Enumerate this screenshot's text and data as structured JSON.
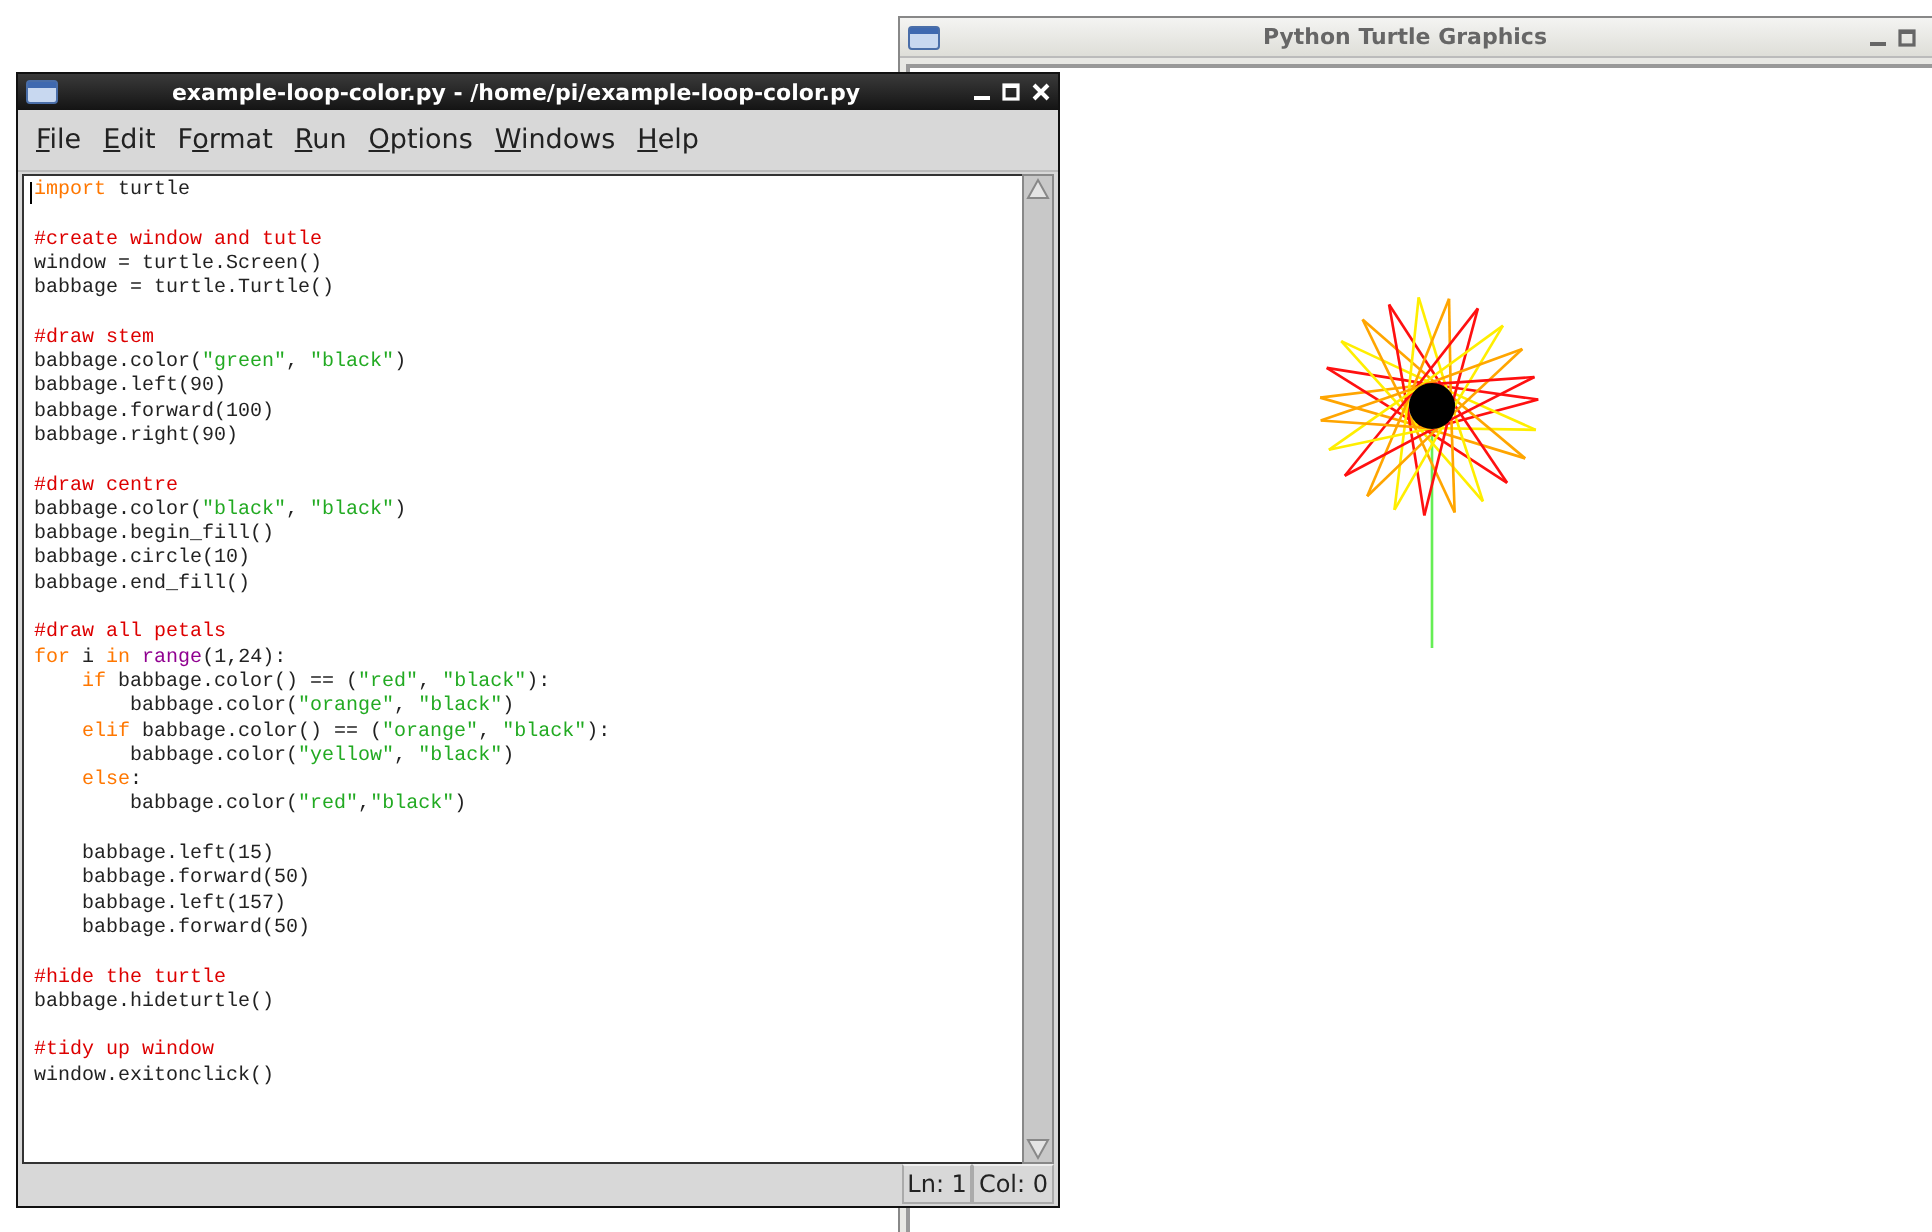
{
  "turtle_window": {
    "title": "Python Turtle Graphics"
  },
  "editor_window": {
    "title": "example-loop-color.py - /home/pi/example-loop-color.py",
    "menu": [
      {
        "key": "F",
        "post": "ile"
      },
      {
        "key": "E",
        "post": "dit"
      },
      {
        "pre": "F",
        "key": "o",
        "post": "rmat"
      },
      {
        "key": "R",
        "post": "un"
      },
      {
        "key": "O",
        "post": "ptions"
      },
      {
        "key": "W",
        "post": "indows"
      },
      {
        "key": "H",
        "post": "elp"
      }
    ],
    "lines": [
      {
        "kind": "code",
        "tokens": [
          {
            "kind": "keyword",
            "text": "import"
          },
          {
            "kind": "plain",
            "text": " turtle"
          }
        ]
      },
      {
        "kind": "blank"
      },
      {
        "kind": "code",
        "tokens": [
          {
            "kind": "comment",
            "text": "#create window and tutle"
          }
        ]
      },
      {
        "kind": "code",
        "tokens": [
          {
            "kind": "plain",
            "text": "window = turtle.Screen()"
          }
        ]
      },
      {
        "kind": "code",
        "tokens": [
          {
            "kind": "plain",
            "text": "babbage = turtle.Turtle()"
          }
        ]
      },
      {
        "kind": "blank"
      },
      {
        "kind": "code",
        "tokens": [
          {
            "kind": "comment",
            "text": "#draw stem"
          }
        ]
      },
      {
        "kind": "code",
        "tokens": [
          {
            "kind": "plain",
            "text": "babbage.color("
          },
          {
            "kind": "string",
            "text": "\"green\""
          },
          {
            "kind": "plain",
            "text": ", "
          },
          {
            "kind": "string",
            "text": "\"black\""
          },
          {
            "kind": "plain",
            "text": ")"
          }
        ]
      },
      {
        "kind": "code",
        "tokens": [
          {
            "kind": "plain",
            "text": "babbage.left(90)"
          }
        ]
      },
      {
        "kind": "code",
        "tokens": [
          {
            "kind": "plain",
            "text": "babbage.forward(100)"
          }
        ]
      },
      {
        "kind": "code",
        "tokens": [
          {
            "kind": "plain",
            "text": "babbage.right(90)"
          }
        ]
      },
      {
        "kind": "blank"
      },
      {
        "kind": "code",
        "tokens": [
          {
            "kind": "comment",
            "text": "#draw centre"
          }
        ]
      },
      {
        "kind": "code",
        "tokens": [
          {
            "kind": "plain",
            "text": "babbage.color("
          },
          {
            "kind": "string",
            "text": "\"black\""
          },
          {
            "kind": "plain",
            "text": ", "
          },
          {
            "kind": "string",
            "text": "\"black\""
          },
          {
            "kind": "plain",
            "text": ")"
          }
        ]
      },
      {
        "kind": "code",
        "tokens": [
          {
            "kind": "plain",
            "text": "babbage.begin_fill()"
          }
        ]
      },
      {
        "kind": "code",
        "tokens": [
          {
            "kind": "plain",
            "text": "babbage.circle(10)"
          }
        ]
      },
      {
        "kind": "code",
        "tokens": [
          {
            "kind": "plain",
            "text": "babbage.end_fill()"
          }
        ]
      },
      {
        "kind": "blank"
      },
      {
        "kind": "code",
        "tokens": [
          {
            "kind": "comment",
            "text": "#draw all petals"
          }
        ]
      },
      {
        "kind": "code",
        "tokens": [
          {
            "kind": "keyword",
            "text": "for"
          },
          {
            "kind": "plain",
            "text": " i "
          },
          {
            "kind": "keyword",
            "text": "in "
          },
          {
            "kind": "builtin",
            "text": "range"
          },
          {
            "kind": "plain",
            "text": "(1,24):"
          }
        ]
      },
      {
        "kind": "code",
        "tokens": [
          {
            "kind": "keyword",
            "text": "    if"
          },
          {
            "kind": "plain",
            "text": " babbage.color() == ("
          },
          {
            "kind": "string",
            "text": "\"red\""
          },
          {
            "kind": "plain",
            "text": ", "
          },
          {
            "kind": "string",
            "text": "\"black\""
          },
          {
            "kind": "plain",
            "text": "):"
          }
        ]
      },
      {
        "kind": "code",
        "tokens": [
          {
            "kind": "plain",
            "text": "        babbage.color("
          },
          {
            "kind": "string",
            "text": "\"orange\""
          },
          {
            "kind": "plain",
            "text": ", "
          },
          {
            "kind": "string",
            "text": "\"black\""
          },
          {
            "kind": "plain",
            "text": ")"
          }
        ]
      },
      {
        "kind": "code",
        "tokens": [
          {
            "kind": "keyword",
            "text": "    elif"
          },
          {
            "kind": "plain",
            "text": " babbage.color() == ("
          },
          {
            "kind": "string",
            "text": "\"orange\""
          },
          {
            "kind": "plain",
            "text": ", "
          },
          {
            "kind": "string",
            "text": "\"black\""
          },
          {
            "kind": "plain",
            "text": "):"
          }
        ]
      },
      {
        "kind": "code",
        "tokens": [
          {
            "kind": "plain",
            "text": "        babbage.color("
          },
          {
            "kind": "string",
            "text": "\"yellow\""
          },
          {
            "kind": "plain",
            "text": ", "
          },
          {
            "kind": "string",
            "text": "\"black\""
          },
          {
            "kind": "plain",
            "text": ")"
          }
        ]
      },
      {
        "kind": "code",
        "tokens": [
          {
            "kind": "keyword",
            "text": "    else"
          },
          {
            "kind": "plain",
            "text": ":"
          }
        ]
      },
      {
        "kind": "code",
        "tokens": [
          {
            "kind": "plain",
            "text": "        babbage.color("
          },
          {
            "kind": "string",
            "text": "\"red\""
          },
          {
            "kind": "plain",
            "text": ","
          },
          {
            "kind": "string",
            "text": "\"black\""
          },
          {
            "kind": "plain",
            "text": ")"
          }
        ]
      },
      {
        "kind": "blank"
      },
      {
        "kind": "code",
        "tokens": [
          {
            "kind": "plain",
            "text": "    babbage.left(15)"
          }
        ]
      },
      {
        "kind": "code",
        "tokens": [
          {
            "kind": "plain",
            "text": "    babbage.forward(50)"
          }
        ]
      },
      {
        "kind": "code",
        "tokens": [
          {
            "kind": "plain",
            "text": "    babbage.left(157)"
          }
        ]
      },
      {
        "kind": "code",
        "tokens": [
          {
            "kind": "plain",
            "text": "    babbage.forward(50)"
          }
        ]
      },
      {
        "kind": "blank"
      },
      {
        "kind": "code",
        "tokens": [
          {
            "kind": "comment",
            "text": "#hide the turtle"
          }
        ]
      },
      {
        "kind": "code",
        "tokens": [
          {
            "kind": "plain",
            "text": "babbage.hideturtle()"
          }
        ]
      },
      {
        "kind": "blank"
      },
      {
        "kind": "code",
        "tokens": [
          {
            "kind": "comment",
            "text": "#tidy up window"
          }
        ]
      },
      {
        "kind": "code",
        "tokens": [
          {
            "kind": "plain",
            "text": "window.exitonclick()"
          }
        ]
      }
    ],
    "status": {
      "line": "Ln: 1",
      "column": "Col: 0"
    }
  }
}
